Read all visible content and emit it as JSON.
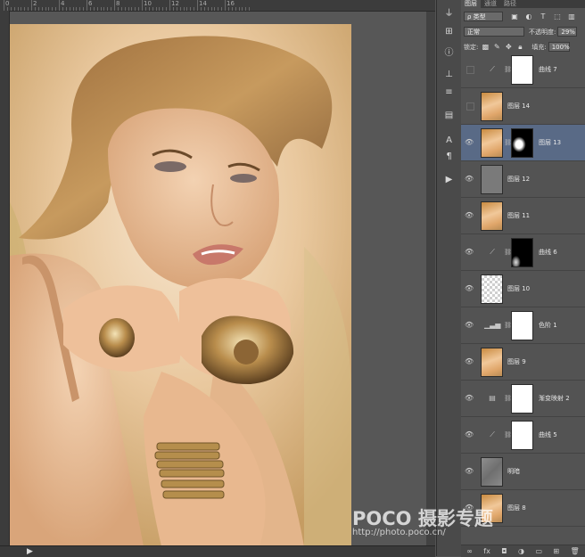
{
  "ruler_numbers": [
    "0",
    "2",
    "4",
    "6",
    "8",
    "10",
    "12",
    "14",
    "16"
  ],
  "statusbar": {
    "arrow": "▶"
  },
  "panel": {
    "tabs": [
      "图层",
      "通道",
      "路径"
    ],
    "filter_kind": "ρ 类型",
    "blend_mode": "正常",
    "opacity_label": "不透明度:",
    "opacity_value": "29%",
    "lock_label": "锁定:",
    "fill_label": "填充:",
    "fill_value": "100%"
  },
  "layers": [
    {
      "name": "曲线 7",
      "thumb": "adj",
      "adj_icon": "curves-icon",
      "mask": "white",
      "visible": false
    },
    {
      "name": "图层 14",
      "thumb": "photo",
      "mask": "none",
      "visible": false
    },
    {
      "name": "图层 13",
      "thumb": "photo",
      "mask": "partial",
      "visible": true,
      "selected": true
    },
    {
      "name": "图层 12",
      "thumb": "gray",
      "mask": "none",
      "visible": true
    },
    {
      "name": "图层 11",
      "thumb": "photo",
      "mask": "none",
      "visible": true
    },
    {
      "name": "曲线 6",
      "thumb": "adj",
      "adj_icon": "curves-icon",
      "mask": "lowstroke",
      "visible": true
    },
    {
      "name": "图层 10",
      "thumb": "trans",
      "mask": "none",
      "visible": true
    },
    {
      "name": "色阶 1",
      "thumb": "adj",
      "adj_icon": "levels-icon",
      "mask": "white",
      "visible": true
    },
    {
      "name": "图层 9",
      "thumb": "photo",
      "mask": "none",
      "visible": true
    },
    {
      "name": "渐变映射 2",
      "thumb": "adj",
      "adj_icon": "gradient-map-icon",
      "mask": "white",
      "visible": true
    },
    {
      "name": "曲线 5",
      "thumb": "adj",
      "adj_icon": "curves-icon",
      "mask": "white",
      "visible": true
    },
    {
      "name": "明暗",
      "thumb": "texture",
      "mask": "none",
      "visible": true
    },
    {
      "name": "图层 8",
      "thumb": "photo",
      "mask": "none",
      "visible": true
    }
  ],
  "watermark": {
    "brand": "POCO 摄影专题",
    "url": "http://photo.poco.cn/"
  }
}
